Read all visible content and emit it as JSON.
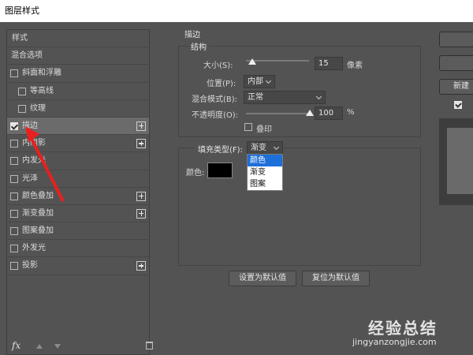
{
  "window": {
    "title": "图层样式"
  },
  "sidebar": {
    "header_label": "样式",
    "items": [
      {
        "label": "混合选项",
        "checkbox": false,
        "checked": false,
        "plus": false,
        "selected": false,
        "indent": 0
      },
      {
        "label": "斜面和浮雕",
        "checkbox": true,
        "checked": false,
        "plus": false,
        "selected": false,
        "indent": 0
      },
      {
        "label": "等高线",
        "checkbox": true,
        "checked": false,
        "plus": false,
        "selected": false,
        "indent": 1
      },
      {
        "label": "纹理",
        "checkbox": true,
        "checked": false,
        "plus": false,
        "selected": false,
        "indent": 1
      },
      {
        "label": "描边",
        "checkbox": true,
        "checked": true,
        "plus": true,
        "selected": true,
        "indent": 0
      },
      {
        "label": "内阴影",
        "checkbox": true,
        "checked": false,
        "plus": true,
        "selected": false,
        "indent": 0
      },
      {
        "label": "内发光",
        "checkbox": true,
        "checked": false,
        "plus": false,
        "selected": false,
        "indent": 0
      },
      {
        "label": "光泽",
        "checkbox": true,
        "checked": false,
        "plus": false,
        "selected": false,
        "indent": 0
      },
      {
        "label": "颜色叠加",
        "checkbox": true,
        "checked": false,
        "plus": true,
        "selected": false,
        "indent": 0
      },
      {
        "label": "渐变叠加",
        "checkbox": true,
        "checked": false,
        "plus": true,
        "selected": false,
        "indent": 0
      },
      {
        "label": "图案叠加",
        "checkbox": true,
        "checked": false,
        "plus": false,
        "selected": false,
        "indent": 0
      },
      {
        "label": "外发光",
        "checkbox": true,
        "checked": false,
        "plus": false,
        "selected": false,
        "indent": 0
      },
      {
        "label": "投影",
        "checkbox": true,
        "checked": false,
        "plus": true,
        "selected": false,
        "indent": 0
      }
    ],
    "footer_fx": "fx",
    "footer_icons": [
      "move-up-icon",
      "move-down-icon",
      "trash-icon"
    ]
  },
  "annotation": {
    "arrow_color": "#e8201e"
  },
  "stroke_panel": {
    "title": "描边",
    "structure_group_title": "结构",
    "size_label": "大小(S):",
    "size_value": "15",
    "size_unit": "像素",
    "position_label": "位置(P):",
    "position_value": "内部",
    "blend_mode_label": "混合模式(B):",
    "blend_mode_value": "正常",
    "opacity_label": "不透明度(O):",
    "opacity_value": "100",
    "opacity_unit": "%",
    "overprint_label": "叠印",
    "fill_type_label": "填充类型(F):",
    "fill_type_value": "渐变",
    "fill_type_options": [
      "颜色",
      "渐变",
      "图案"
    ],
    "fill_type_highlighted": "颜色",
    "color_label": "颜色:",
    "color_swatch": "#000000",
    "set_default_button": "设置为默认值",
    "reset_default_button": "复位为默认值"
  },
  "right_panel": {
    "new_style_button": "新建"
  },
  "watermark": {
    "brand": "经验总结",
    "url": "jingyanzongjie.com"
  },
  "colors": {
    "background": "#535353",
    "selected_row": "#6b6b6b",
    "highlight": "#1e6fd9"
  }
}
